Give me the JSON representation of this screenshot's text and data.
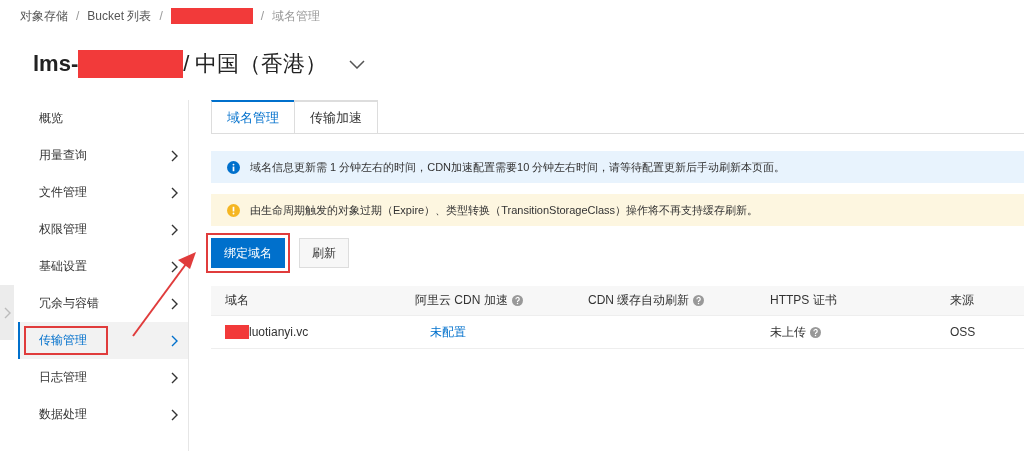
{
  "breadcrumb": [
    {
      "kind": "text",
      "label": "对象存储"
    },
    {
      "kind": "separator",
      "label": "/"
    },
    {
      "kind": "text",
      "label": "Bucket 列表"
    },
    {
      "kind": "separator",
      "label": "/"
    },
    {
      "kind": "redacted"
    },
    {
      "kind": "separator",
      "label": "/"
    },
    {
      "kind": "current",
      "label": "域名管理"
    }
  ],
  "title": {
    "prefix": "lms-",
    "redacted": true,
    "suffix": "/ 中国（香港）"
  },
  "sidebar": {
    "items": [
      {
        "label": "概览",
        "arrow": false,
        "selected": false,
        "highlighted": false
      },
      {
        "label": "用量查询",
        "arrow": true,
        "selected": false,
        "highlighted": false
      },
      {
        "label": "文件管理",
        "arrow": true,
        "selected": false,
        "highlighted": false
      },
      {
        "label": "权限管理",
        "arrow": true,
        "selected": false,
        "highlighted": false
      },
      {
        "label": "基础设置",
        "arrow": true,
        "selected": false,
        "highlighted": false
      },
      {
        "label": "冗余与容错",
        "arrow": true,
        "selected": false,
        "highlighted": false
      },
      {
        "label": "传输管理",
        "arrow": true,
        "selected": true,
        "highlighted": true
      },
      {
        "label": "日志管理",
        "arrow": true,
        "selected": false,
        "highlighted": false
      },
      {
        "label": "数据处理",
        "arrow": true,
        "selected": false,
        "highlighted": false
      }
    ]
  },
  "tabs": [
    {
      "label": "域名管理",
      "selected": true
    },
    {
      "label": "传输加速",
      "selected": false
    }
  ],
  "alerts": [
    {
      "kind": "info",
      "text": "域名信息更新需 1 分钟左右的时间，CDN加速配置需要10 分钟左右时间，请等待配置更新后手动刷新本页面。"
    },
    {
      "kind": "warning",
      "text": "由生命周期触发的对象过期（Expire）、类型转换（TransitionStorageClass）操作将不再支持缓存刷新。"
    }
  ],
  "buttons": [
    {
      "label": "绑定域名",
      "kind": "primary",
      "highlighted": true
    },
    {
      "label": "刷新",
      "kind": "default",
      "highlighted": false
    }
  ],
  "table": {
    "columns": [
      {
        "label": "域名",
        "help": false
      },
      {
        "label": "阿里云 CDN 加速",
        "help": true
      },
      {
        "label": "CDN 缓存自动刷新",
        "help": true
      },
      {
        "label": "HTTPS 证书",
        "help": false
      },
      {
        "label": "来源",
        "help": false
      }
    ],
    "rows": [
      {
        "domain": {
          "text": "luotianyi.vc",
          "redacted": true
        },
        "cdn": "未配置",
        "https": {
          "text": "未上传",
          "help": true
        },
        "source": "OSS"
      }
    ]
  }
}
